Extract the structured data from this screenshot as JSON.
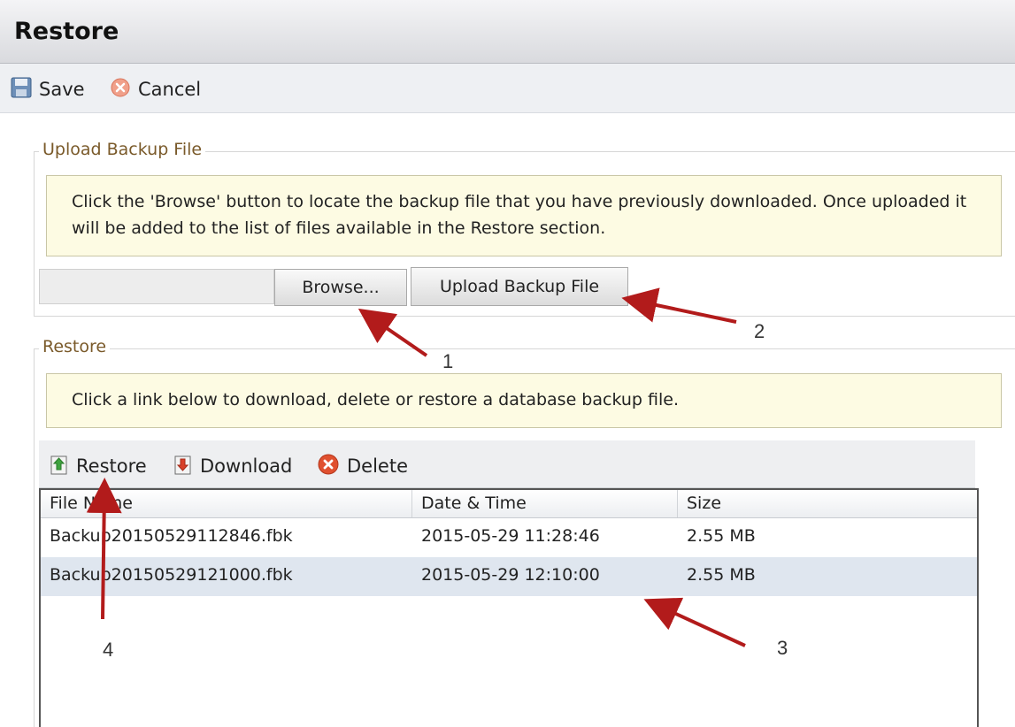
{
  "window": {
    "title": "Restore"
  },
  "toolbar": {
    "save_label": "Save",
    "cancel_label": "Cancel"
  },
  "upload_section": {
    "legend": "Upload Backup File",
    "note": "Click the 'Browse' button to locate the backup file that you have previously downloaded. Once uploaded it will be added to the list of files available in the Restore section.",
    "file_path_value": "",
    "browse_label": "Browse...",
    "upload_label": "Upload Backup File"
  },
  "restore_section": {
    "legend": "Restore",
    "note": "Click a link below to download, delete or restore a database backup file.",
    "actions": {
      "restore_label": "Restore",
      "download_label": "Download",
      "delete_label": "Delete"
    },
    "columns": [
      "File Name",
      "Date & Time",
      "Size"
    ],
    "rows": [
      {
        "file_name": "Backup20150529112846.fbk",
        "date_time": "2015-05-29 11:28:46",
        "size": "2.55 MB",
        "selected": false
      },
      {
        "file_name": "Backup20150529121000.fbk",
        "date_time": "2015-05-29 12:10:00",
        "size": "2.55 MB",
        "selected": true
      }
    ]
  },
  "annotations": {
    "arrow_color": "#b21b1b",
    "labels": [
      "1",
      "2",
      "3",
      "4"
    ]
  },
  "colors": {
    "note_background": "#fdfbe3",
    "legend_text": "#7a5a2a",
    "selected_row": "#dfe6ef"
  }
}
